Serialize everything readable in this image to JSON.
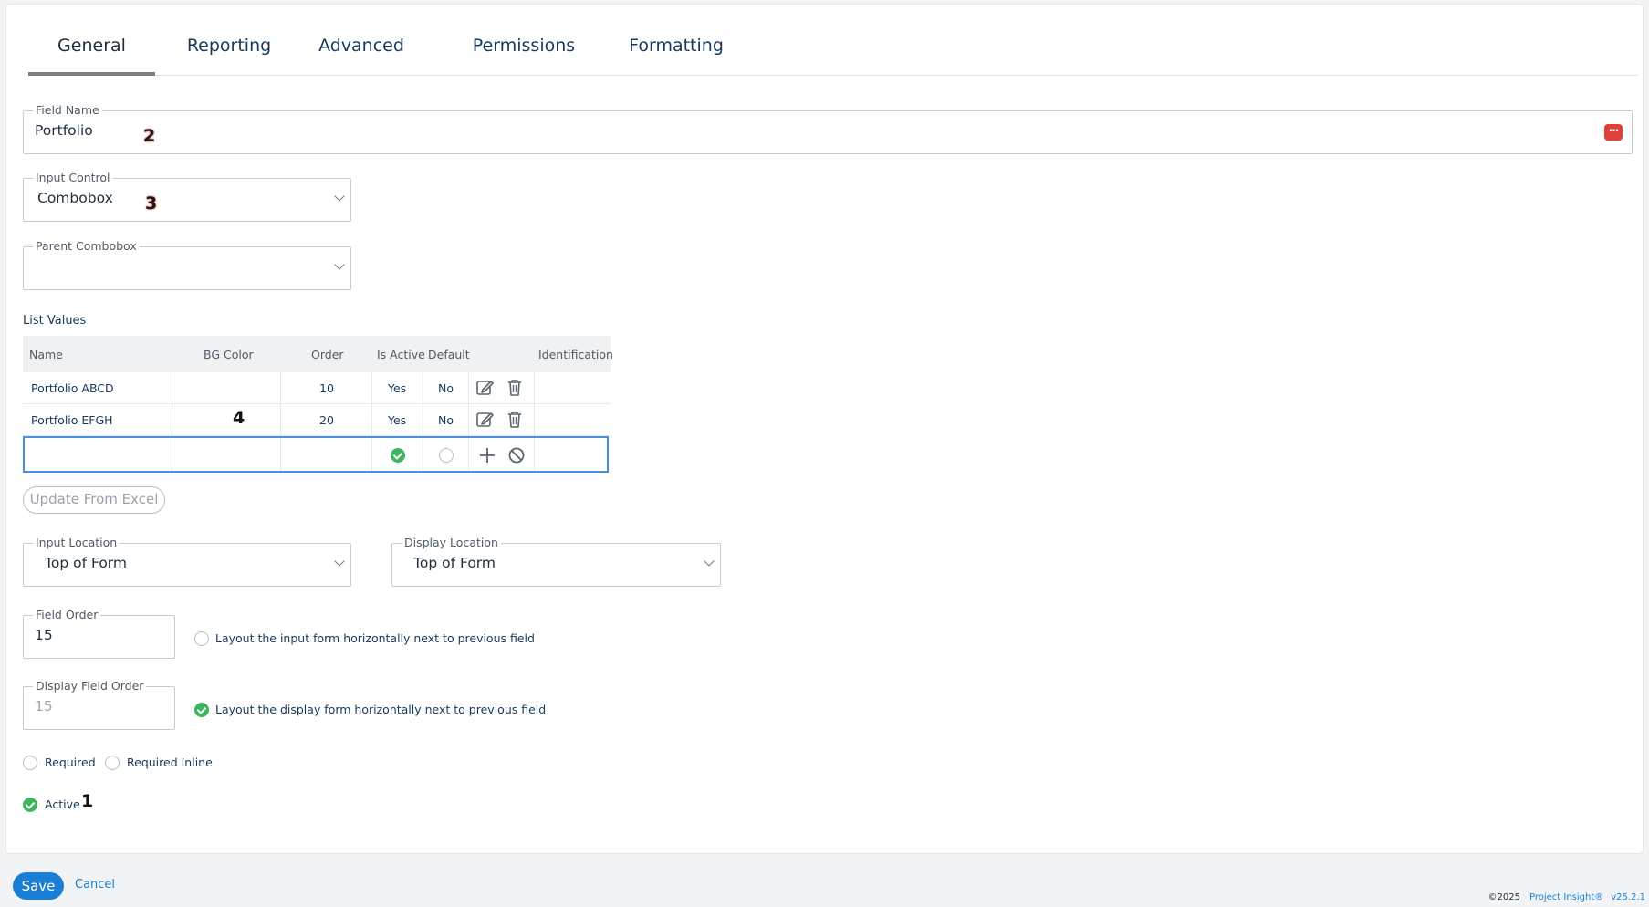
{
  "tabs": [
    {
      "label": "General"
    },
    {
      "label": "Reporting"
    },
    {
      "label": "Advanced"
    },
    {
      "label": "Permissions"
    },
    {
      "label": "Formatting"
    }
  ],
  "field_name": {
    "label": "Field Name",
    "value": "Portfolio"
  },
  "input_control": {
    "label": "Input Control",
    "value": "Combobox"
  },
  "parent_combobox": {
    "label": "Parent Combobox",
    "value": ""
  },
  "list_values": {
    "label": "List Values",
    "columns": [
      "Name",
      "BG Color",
      "Order",
      "Is Active",
      "Default",
      "Identification"
    ],
    "rows": [
      {
        "name": "Portfolio ABCD",
        "bg_color": "",
        "order": "10",
        "is_active": "Yes",
        "default": "No",
        "identification": ""
      },
      {
        "name": "Portfolio EFGH",
        "bg_color": "",
        "order": "20",
        "is_active": "Yes",
        "default": "No",
        "identification": ""
      }
    ]
  },
  "update_from_excel": "Update From Excel",
  "input_location": {
    "label": "Input Location",
    "value": "Top of Form"
  },
  "display_location": {
    "label": "Display Location",
    "value": "Top of Form"
  },
  "field_order": {
    "label": "Field Order",
    "value": "15"
  },
  "layout_input_horizontal": {
    "label": "Layout the input form horizontally next to previous field",
    "checked": false
  },
  "display_field_order": {
    "label": "Display Field Order",
    "value": "15"
  },
  "layout_display_horizontal": {
    "label": "Layout the display form horizontally next to previous field",
    "checked": true
  },
  "required": {
    "label": "Required",
    "checked": false
  },
  "required_inline": {
    "label": "Required Inline",
    "checked": false
  },
  "active": {
    "label": "Active",
    "checked": true
  },
  "markers": {
    "m1": "1",
    "m2": "2",
    "m3": "3",
    "m4": "4"
  },
  "footer_actions": {
    "save": "Save",
    "cancel": "Cancel"
  },
  "footer": {
    "copyright": "©2025",
    "product": "Project Insight®",
    "version": "v25.2.1"
  },
  "colors": {
    "accent": "#1a7fd4",
    "check": "#3cb55e",
    "danger": "#e0413a",
    "new_row_border": "#4a90e2"
  }
}
